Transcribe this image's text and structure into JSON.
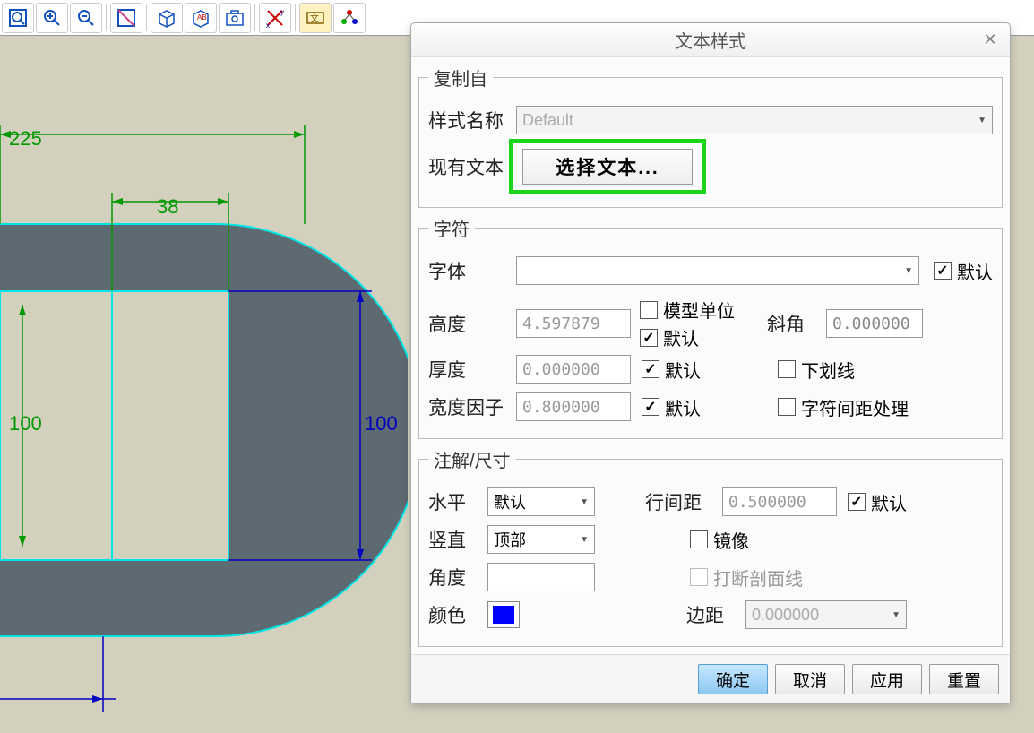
{
  "toolbar": {
    "icons": [
      "zoom-fit",
      "zoom-in",
      "zoom-out",
      "zoom-window",
      "box-3d",
      "text-ab",
      "camera-capture",
      "axis-toggle",
      "text-format",
      "rgb-axis"
    ]
  },
  "canvas": {
    "dim_225": "225",
    "dim_38": "38",
    "dim_100_left": "100",
    "dim_100_right": "100"
  },
  "dialog": {
    "title": "文本样式",
    "copy_section": {
      "legend": "复制自",
      "style_name_label": "样式名称",
      "style_name_value": "Default",
      "existing_text_label": "现有文本",
      "select_text_btn": "选择文本..."
    },
    "char_section": {
      "legend": "字符",
      "font_label": "字体",
      "font_value": "",
      "default_label": "默认",
      "height_label": "高度",
      "height_value": "4.597879",
      "model_unit_label": "模型单位",
      "slant_label": "斜角",
      "slant_value": "0.000000",
      "thickness_label": "厚度",
      "thickness_value": "0.000000",
      "underline_label": "下划线",
      "width_factor_label": "宽度因子",
      "width_factor_value": "0.800000",
      "char_spacing_label": "字符间距处理"
    },
    "annot_section": {
      "legend": "注解/尺寸",
      "horiz_label": "水平",
      "horiz_value": "默认",
      "line_spacing_label": "行间距",
      "line_spacing_value": "0.500000",
      "vert_label": "竖直",
      "vert_value": "顶部",
      "mirror_label": "镜像",
      "angle_label": "角度",
      "angle_value": "",
      "break_section_label": "打断剖面线",
      "color_label": "颜色",
      "color_value": "#0000ff",
      "margin_label": "边距",
      "margin_value": "0.000000"
    },
    "buttons": {
      "ok": "确定",
      "cancel": "取消",
      "apply": "应用",
      "reset": "重置"
    }
  }
}
